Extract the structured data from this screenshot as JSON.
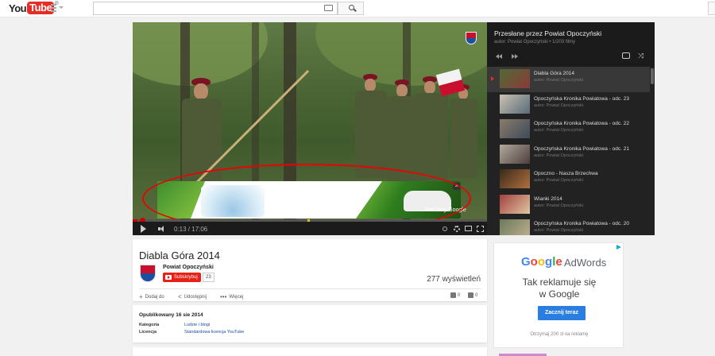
{
  "masthead": {
    "logo_you": "You",
    "logo_tube": "Tube",
    "logo_reg": "®",
    "search_value": "",
    "search_placeholder": ""
  },
  "player": {
    "current_time": "0:13 / 17:06",
    "progress_fraction": 0.013,
    "ad_label": "Reklamy Google",
    "ad_close": "×"
  },
  "playlist": {
    "title": "Przesłane przez Powiat Opoczyński",
    "subtitle": "autor: Powiat Opoczyński • 1/203 filmy",
    "shuffle_glyph": "⤨",
    "items": [
      {
        "title": "Diabla Góra 2014",
        "author": "autor: Powiat Opoczyński",
        "active": true
      },
      {
        "title": "Opoczyńska Kronika Powiatowa - odc. 23",
        "author": "autor: Powiat Opoczyński",
        "active": false
      },
      {
        "title": "Opoczyńska Kronika Powiatowa - odc. 22",
        "author": "autor: Powiat Opoczyński",
        "active": false
      },
      {
        "title": "Opoczyńska Kronika Powiatowa - odc. 21",
        "author": "autor: Powiat Opoczyński",
        "active": false
      },
      {
        "title": "Opoczno - Nasza Brzechwa",
        "author": "autor: Powiat Opoczyński",
        "active": false
      },
      {
        "title": "Wianki 2014",
        "author": "autor: Powiat Opoczyński",
        "active": false
      },
      {
        "title": "Opoczyńska Kronika Powiatowa - odc. 20",
        "author": "autor: Powiat Opoczyński",
        "active": false
      }
    ]
  },
  "video": {
    "title": "Diabla Góra 2014",
    "channel": "Powiat Opoczyński",
    "subscribe_label": "Subskrybuj",
    "subscriber_count": "23",
    "views": "277 wyświetleń",
    "actions": {
      "add_label": "Dodaj do",
      "share_label": "Udostępnij",
      "more_label": "Więcej"
    },
    "likes": "0",
    "dislikes": "0"
  },
  "description": {
    "published": "Opublikowany 16 sie 2014",
    "category_label": "Kategoria",
    "category_value": "Ludzie i blogi",
    "license_label": "Licencja",
    "license_value": "Standardowa licencja YouTube"
  },
  "ad": {
    "google_letters": [
      "G",
      "o",
      "o",
      "g",
      "l",
      "e"
    ],
    "google_colors": [
      "#4285f4",
      "#ea4335",
      "#fbbc05",
      "#4285f4",
      "#34a853",
      "#ea4335"
    ],
    "adwords": "AdWords",
    "tagline_line1": "Tak reklamuje się",
    "tagline_line2": "w Google",
    "cta": "Zacznij teraz",
    "footer": "Otrzymaj 200 zł na reklamę"
  }
}
